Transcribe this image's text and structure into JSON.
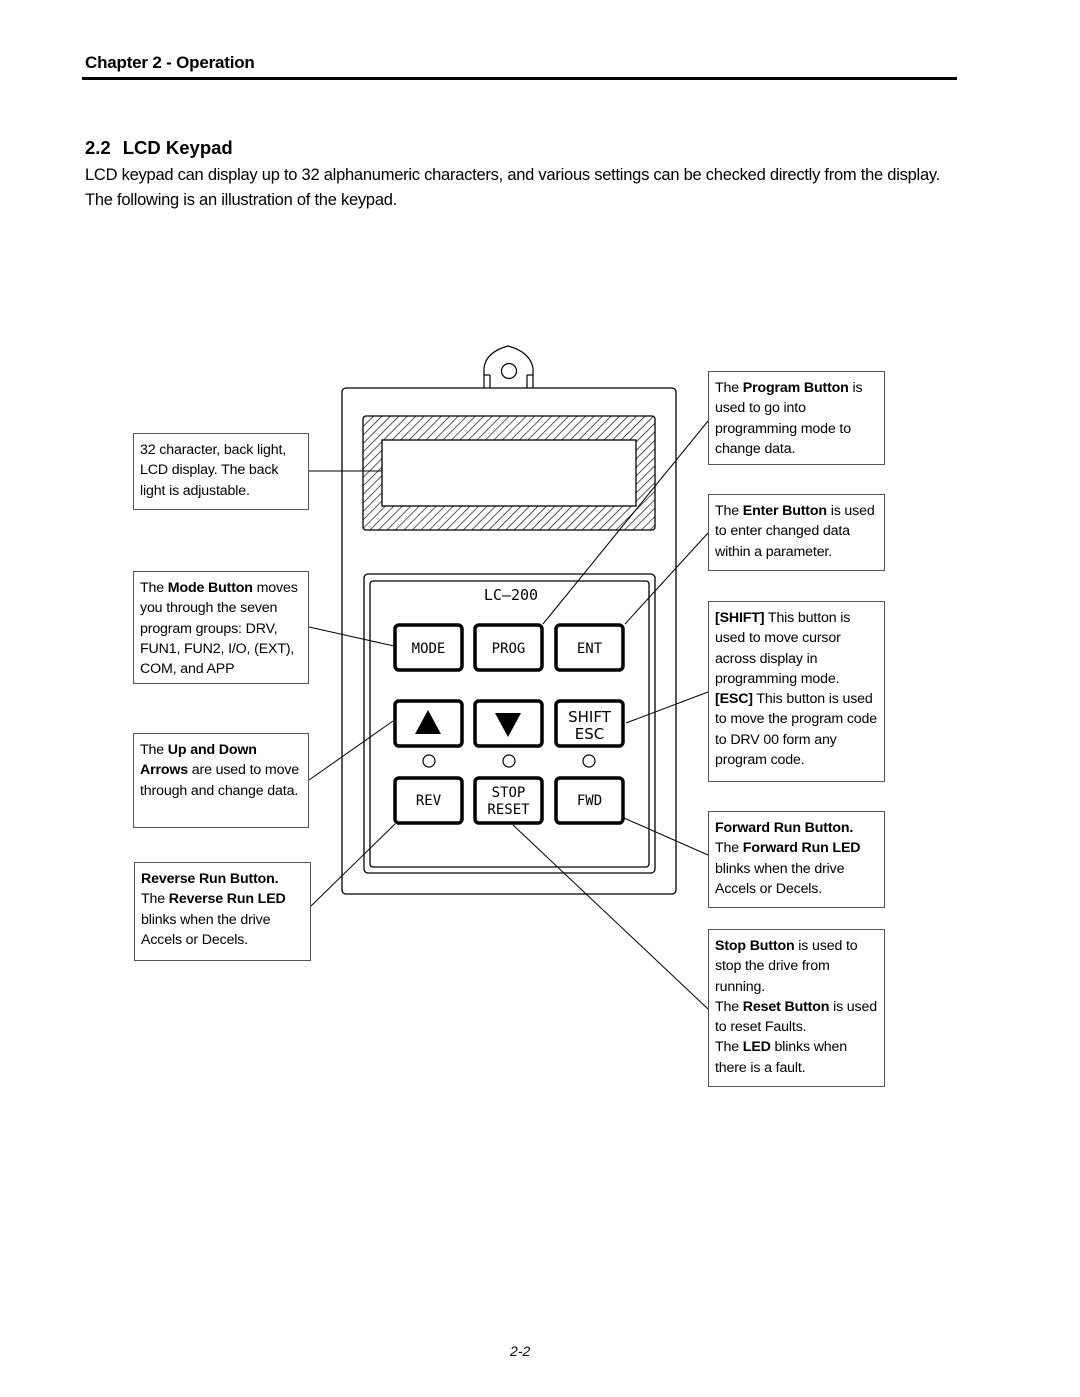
{
  "header": {
    "chapter": "Chapter 2 - Operation"
  },
  "section": {
    "number": "2.2",
    "title": "LCD Keypad",
    "intro_line1": "LCD keypad can display up to 32 alphanumeric characters, and various settings can be checked directly from the display.",
    "intro_line2": "The following is an illustration of the keypad."
  },
  "keypad": {
    "model": "LC—200",
    "buttons": {
      "mode": "MODE",
      "prog": "PROG",
      "ent": "ENT",
      "up": "▲",
      "down": "▼",
      "shift": "SHIFT",
      "esc": "ESC",
      "rev": "REV",
      "stop": "STOP",
      "reset": "RESET",
      "fwd": "FWD"
    }
  },
  "callouts": {
    "lcd": {
      "text": "32 character, back light, LCD display. The back light is adjustable."
    },
    "mode": {
      "pre": "The ",
      "bold": "Mode Button",
      "post": " moves you through the seven program groups: DRV, FUN1, FUN2, I/O, (EXT), COM, and APP"
    },
    "arrows": {
      "pre": "The ",
      "bold": "Up and Down Arrows",
      "post": " are used to move through and change data."
    },
    "reverse": {
      "bold1": "Reverse Run Button.",
      "pre2": "The ",
      "bold2": "Reverse Run LED",
      "post2": " blinks when the drive Accels or Decels."
    },
    "program": {
      "pre": "The ",
      "bold": "Program Button",
      "post": " is used to go into programming mode to change data."
    },
    "enter": {
      "pre": "The ",
      "bold": "Enter Button",
      "post": " is used to enter changed data within a parameter."
    },
    "shift": {
      "bold1": "[SHIFT]",
      "post1": " This button is used to move cursor across display in programming mode.",
      "bold2": "[ESC]",
      "post2": " This button is used to move the program code to DRV 00 form any program code."
    },
    "forward": {
      "bold1": "Forward Run Button.",
      "pre2": "The ",
      "bold2": "Forward Run LED",
      "post2": " blinks when the drive Accels or Decels."
    },
    "stop": {
      "bold1": "Stop Button",
      "post1": " is used to stop the drive from running.",
      "pre2": "The ",
      "bold2": "Reset Button",
      "post2": " is used to reset Faults.",
      "pre3": "The ",
      "bold3": "LED",
      "post3": " blinks when there is a fault."
    }
  },
  "footer": {
    "page_number": "2-2"
  }
}
